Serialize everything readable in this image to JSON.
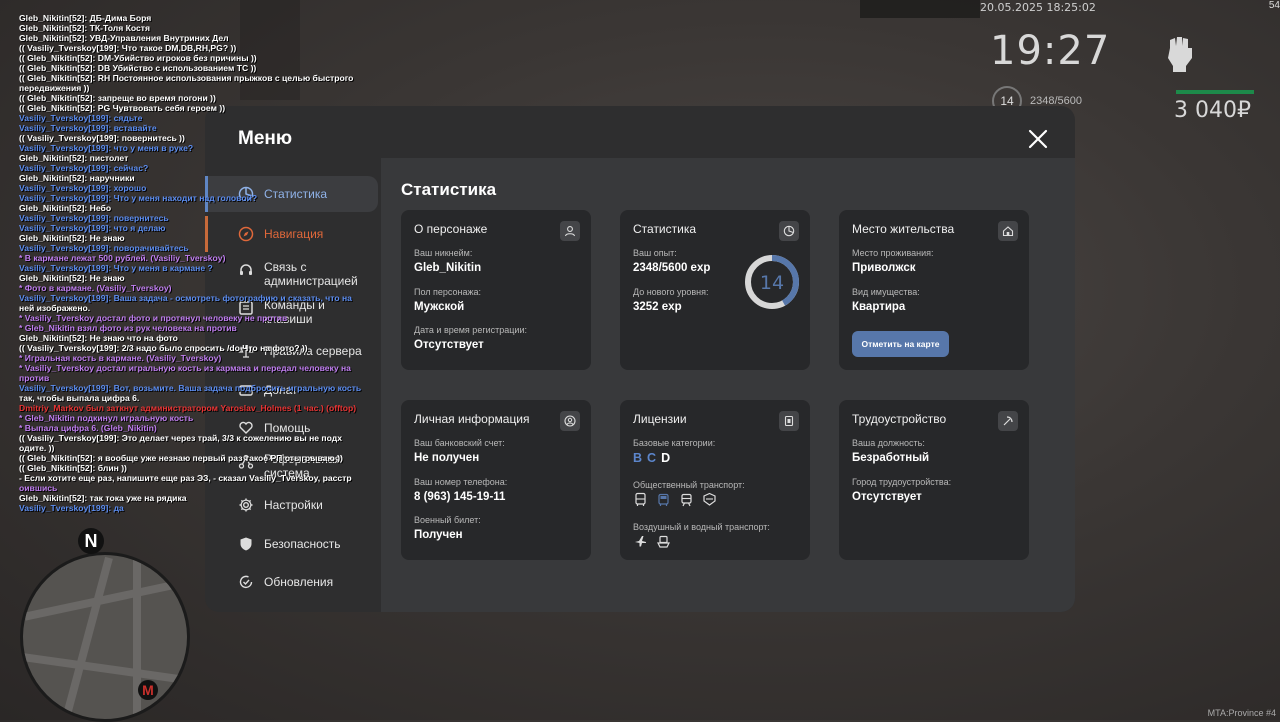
{
  "hud": {
    "datetime": "20.05.2025 18:25:02",
    "corner_fps": "54",
    "clock": "19:27",
    "level": "14",
    "exp": "2348/5600",
    "money": "3 040₽",
    "version": "MTA:Province #4"
  },
  "minimap": {
    "north": "N",
    "metro": "M"
  },
  "chat": [
    {
      "t": "Gleb_Nikitin[52]: ДБ-Дима Боря",
      "c": "w"
    },
    {
      "t": "Gleb_Nikitin[52]: ТК-Толя Костя",
      "c": "w"
    },
    {
      "t": "Gleb_Nikitin[52]: УВД-Управления Внутриних Дел",
      "c": "w"
    },
    {
      "t": "(( Vasiliy_Tverskoy[199]: Что такое DM,DB,RH,PG? ))",
      "c": "w"
    },
    {
      "t": "(( Gleb_Nikitin[52]: DM-Убийство игроков без причины ))",
      "c": "w"
    },
    {
      "t": "(( Gleb_Nikitin[52]: DB Убийство с использованием ТС ))",
      "c": "w"
    },
    {
      "t": "(( Gleb_Nikitin[52]: RH Постоянное использования прыжков с целью быстрого",
      "c": "w"
    },
    {
      "t": "передвижения ))",
      "c": "w"
    },
    {
      "t": "(( Gleb_Nikitin[52]: запреще во время погони ))",
      "c": "w"
    },
    {
      "t": "(( Gleb_Nikitin[52]: PG Чувтвовать себя героем ))",
      "c": "w"
    },
    {
      "t": "Vasiliy_Tverskoy[199]: сядьте",
      "c": "b"
    },
    {
      "t": "Vasiliy_Tverskoy[199]: вставайте",
      "c": "b"
    },
    {
      "t": "(( Vasiliy_Tverskoy[199]: повернитесь ))",
      "c": "w"
    },
    {
      "t": "Vasiliy_Tverskoy[199]: что у меня в руке?",
      "c": "b"
    },
    {
      "t": "Gleb_Nikitin[52]: пистолет",
      "c": "w"
    },
    {
      "t": "Vasiliy_Tverskoy[199]: сейчас?",
      "c": "b"
    },
    {
      "t": "Gleb_Nikitin[52]: наручники",
      "c": "w"
    },
    {
      "t": "Vasiliy_Tverskoy[199]: хорошо",
      "c": "b"
    },
    {
      "t": "Vasiliy_Tverskoy[199]: Что у меня находит над головой?",
      "c": "b"
    },
    {
      "t": "Gleb_Nikitin[52]: Небо",
      "c": "w"
    },
    {
      "t": "Vasiliy_Tverskoy[199]: повернитесь",
      "c": "b"
    },
    {
      "t": "Vasiliy_Tverskoy[199]: что я делаю",
      "c": "b"
    },
    {
      "t": "Gleb_Nikitin[52]: Не знаю",
      "c": "w"
    },
    {
      "t": "Vasiliy_Tverskoy[199]: поворачивайтесь",
      "c": "b"
    },
    {
      "t": " * В кармане лежат 500 рублей. (Vasiliy_Tverskoy)",
      "c": "p"
    },
    {
      "t": "Vasiliy_Tverskoy[199]: Что у меня в кармане ?",
      "c": "b"
    },
    {
      "t": "Gleb_Nikitin[52]: Не знаю",
      "c": "w"
    },
    {
      "t": " * Фото в кармане. (Vasiliy_Tverskoy)",
      "c": "p"
    },
    {
      "t": "Vasiliy_Tverskoy[199]: Ваша задача - осмотреть фотографию и сказать, что на",
      "c": "b"
    },
    {
      "t": "ней изображено.",
      "c": "w"
    },
    {
      "t": " * Vasiliy_Tverskoy достал фото и протянул человеку не против",
      "c": "p"
    },
    {
      "t": " * Gleb_Nikitin взял фото из рук человека на против",
      "c": "p"
    },
    {
      "t": "Gleb_Nikitin[52]: Не знаю что на фото",
      "c": "w"
    },
    {
      "t": "(( Vasiliy_Tverskoy[199]: 2/3 надо было спросить /do Что на фото? ))",
      "c": "w"
    },
    {
      "t": " * Игральная кость в кармане. (Vasiliy_Tverskoy)",
      "c": "p"
    },
    {
      "t": " * Vasiliy_Tverskoy достал игральную кость из кармана и передал человеку на",
      "c": "p"
    },
    {
      "t": "против",
      "c": "p"
    },
    {
      "t": "Vasiliy_Tverskoy[199]: Вот, возьмите. Ваша задача подбросить игральную кость",
      "c": "b"
    },
    {
      "t": " так, чтобы выпала цифра 6.",
      "c": "w"
    },
    {
      "t": "Dmitriy_Markov был заткнут администратором Yaroslav_Holmes (1 час.) (offtop)",
      "c": "r"
    },
    {
      "t": " * Gleb_Nikitin подкинул игральную кость",
      "c": "p"
    },
    {
      "t": " * Выпала цифра 6. (Gleb_Nikitin)",
      "c": "p"
    },
    {
      "t": "(( Vasiliy_Tverskoy[199]: Это делает через трай, 3/3 к сожелению вы не подх",
      "c": "w"
    },
    {
      "t": "одите. ))",
      "c": "w"
    },
    {
      "t": "(( Gleb_Nikitin[52]: я вообще уже незнаю первый раз такое РП отыгрываю ))",
      "c": "w"
    },
    {
      "t": "(( Gleb_Nikitin[52]: блин ))",
      "c": "w"
    },
    {
      "t": " - Если хотите еще раз, напишите еще раз ЭЗ, - сказал Vasiliy_Tverskoy, расстр",
      "c": "w"
    },
    {
      "t": "оившись",
      "c": "p"
    },
    {
      "t": "Gleb_Nikitin[52]: так тока уже на рядика",
      "c": "w"
    },
    {
      "t": "Vasiliy_Tverskoy[199]: да",
      "c": "b"
    }
  ],
  "menu": {
    "title": "Меню",
    "nav": [
      {
        "label": "Статистика",
        "icon": "pie-chart-icon"
      },
      {
        "label": "Навигация",
        "icon": "compass-icon"
      },
      {
        "label": "Связь с администрацией",
        "icon": "headset-icon"
      },
      {
        "label": "Команды и клавиши",
        "icon": "keyboard-icon"
      },
      {
        "label": "Правила сервера",
        "icon": "scales-icon"
      },
      {
        "label": "Донат",
        "icon": "wallet-icon"
      },
      {
        "label": "Помощь",
        "icon": "heart-hand-icon"
      },
      {
        "label": "Реферальная система",
        "icon": "network-icon"
      },
      {
        "label": "Настройки",
        "icon": "gear-icon"
      },
      {
        "label": "Безопасность",
        "icon": "shield-icon"
      },
      {
        "label": "Обновления",
        "icon": "refresh-check-icon"
      }
    ],
    "main_title": "Статистика",
    "cards": {
      "character": {
        "title": "О персонаже",
        "nick_label": "Ваш никнейм:",
        "nick": "Gleb_Nikitin",
        "gender_label": "Пол персонажа:",
        "gender": "Мужской",
        "reg_label": "Дата и время регистрации:",
        "reg": "Отсутствует"
      },
      "stats": {
        "title": "Статистика",
        "exp_label": "Ваш опыт:",
        "exp": "2348/5600 exp",
        "next_label": "До нового уровня:",
        "next": "3252 exp",
        "level": "14",
        "progress": 0.419
      },
      "residence": {
        "title": "Место жительства",
        "place_label": "Место проживания:",
        "place": "Приволжск",
        "property_label": "Вид имущества:",
        "property": "Квартира",
        "button": "Отметить на карте"
      },
      "personal": {
        "title": "Личная информация",
        "bank_label": "Ваш банковский счет:",
        "bank": "Не получен",
        "phone_label": "Ваш номер телефона:",
        "phone": "8 (963) 145-19-11",
        "military_label": "Военный билет:",
        "military": "Получен"
      },
      "licenses": {
        "title": "Лицензии",
        "base_label": "Базовые категории:",
        "categories": [
          "B",
          "C",
          "D"
        ],
        "public_label": "Общественный транспорт:",
        "air_label": "Воздушный и водный транспорт:"
      },
      "employment": {
        "title": "Трудоустройство",
        "position_label": "Ваша должность:",
        "position": "Безработный",
        "city_label": "Город трудоустройства:",
        "city": "Отсутствует"
      }
    }
  }
}
